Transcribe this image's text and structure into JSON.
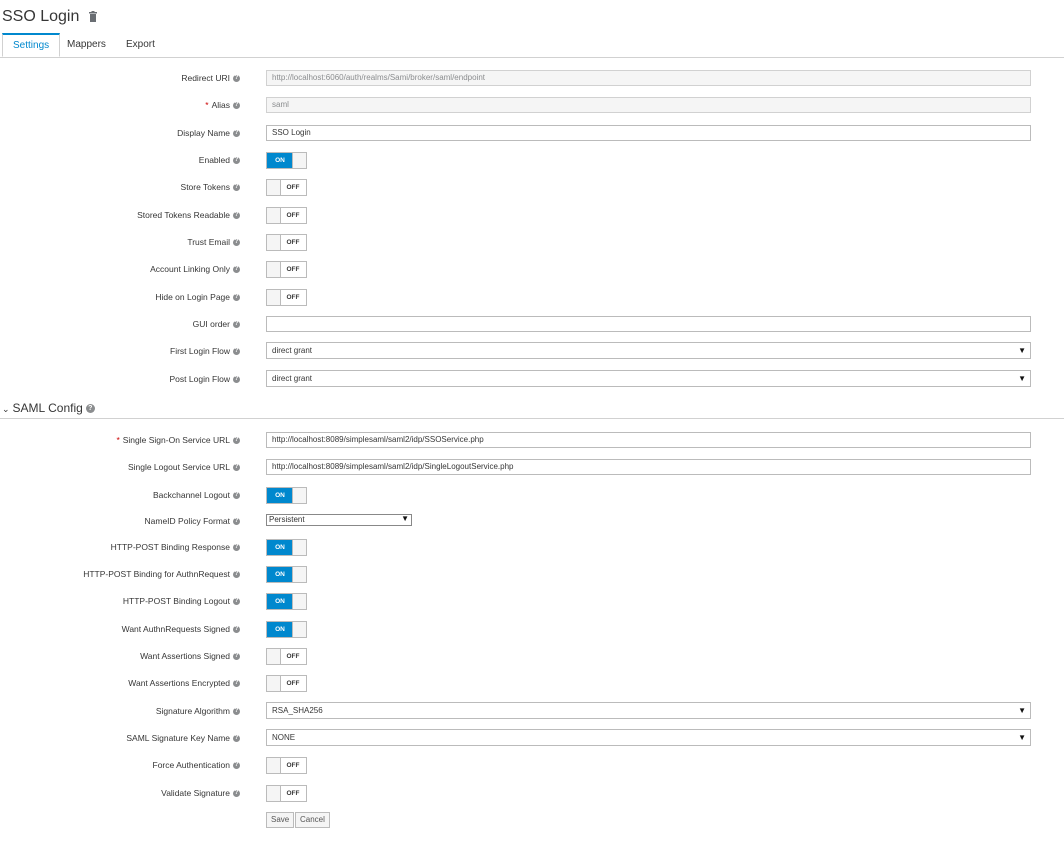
{
  "page": {
    "title": "SSO Login"
  },
  "tabs": [
    {
      "label": "Settings",
      "active": true
    },
    {
      "label": "Mappers",
      "active": false
    },
    {
      "label": "Export",
      "active": false
    }
  ],
  "fields": {
    "redirect_uri": {
      "label": "Redirect URI",
      "value": "http://localhost:6060/auth/realms/Sami/broker/saml/endpoint"
    },
    "alias": {
      "label": "Alias",
      "value": "saml",
      "required": "*"
    },
    "display_name": {
      "label": "Display Name",
      "value": "SSO Login"
    },
    "enabled": {
      "label": "Enabled",
      "state": "ON"
    },
    "store_tokens": {
      "label": "Store Tokens",
      "state": "OFF"
    },
    "stored_tokens_readable": {
      "label": "Stored Tokens Readable",
      "state": "OFF"
    },
    "trust_email": {
      "label": "Trust Email",
      "state": "OFF"
    },
    "account_linking_only": {
      "label": "Account Linking Only",
      "state": "OFF"
    },
    "hide_on_login_page": {
      "label": "Hide on Login Page",
      "state": "OFF"
    },
    "gui_order": {
      "label": "GUI order",
      "value": ""
    },
    "first_login_flow": {
      "label": "First Login Flow",
      "value": "direct grant"
    },
    "post_login_flow": {
      "label": "Post Login Flow",
      "value": "direct grant"
    }
  },
  "saml_section": {
    "title": "SAML Config"
  },
  "saml": {
    "sso_url": {
      "label": "Single Sign-On Service URL",
      "value": "http://localhost:8089/simplesaml/saml2/idp/SSOService.php",
      "required": "*"
    },
    "slo_url": {
      "label": "Single Logout Service URL",
      "value": "http://localhost:8089/simplesaml/saml2/idp/SingleLogoutService.php"
    },
    "backchannel_logout": {
      "label": "Backchannel Logout",
      "state": "ON"
    },
    "nameid_policy_format": {
      "label": "NameID Policy Format",
      "value": "Persistent"
    },
    "post_binding_response": {
      "label": "HTTP-POST Binding Response",
      "state": "ON"
    },
    "post_binding_authn": {
      "label": "HTTP-POST Binding for AuthnRequest",
      "state": "ON"
    },
    "post_binding_logout": {
      "label": "HTTP-POST Binding Logout",
      "state": "ON"
    },
    "want_authn_signed": {
      "label": "Want AuthnRequests Signed",
      "state": "ON"
    },
    "want_assertions_signed": {
      "label": "Want Assertions Signed",
      "state": "OFF"
    },
    "want_assertions_encrypted": {
      "label": "Want Assertions Encrypted",
      "state": "OFF"
    },
    "signature_algorithm": {
      "label": "Signature Algorithm",
      "value": "RSA_SHA256"
    },
    "signature_key_name": {
      "label": "SAML Signature Key Name",
      "value": "NONE"
    },
    "force_authentication": {
      "label": "Force Authentication",
      "state": "OFF"
    },
    "validate_signature": {
      "label": "Validate Signature",
      "state": "OFF"
    }
  },
  "buttons": {
    "save": "Save",
    "cancel": "Cancel"
  },
  "icons": {
    "help": "?",
    "dropdown": "▼",
    "chevron": "⌄"
  },
  "colors": {
    "accent": "#0088ce",
    "required": "#cc0000"
  }
}
